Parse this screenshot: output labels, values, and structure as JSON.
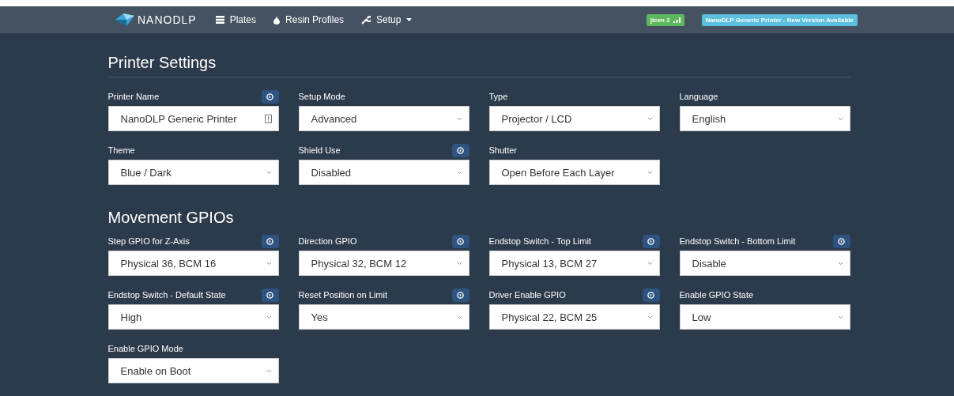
{
  "navbar": {
    "brand": "NANODLP",
    "items": [
      {
        "label": "Plates",
        "dropdown": false
      },
      {
        "label": "Resin Profiles",
        "dropdown": false
      },
      {
        "label": "Setup",
        "dropdown": true
      }
    ],
    "badges": [
      {
        "label": "jicen 2",
        "kind": "wifi",
        "color": "#5cb85c"
      },
      {
        "label": "NanoDLP Generic Printer - New Version Available",
        "kind": "plain",
        "color": "#5bc0de"
      }
    ]
  },
  "sections": [
    {
      "title": "Printer Settings",
      "divider": true,
      "fields": [
        {
          "label": "Printer Name",
          "info": true,
          "kind": "text",
          "value": "NanoDLP Generic Printer"
        },
        {
          "label": "Setup Mode",
          "info": false,
          "kind": "select",
          "value": "Advanced"
        },
        {
          "label": "Type",
          "info": false,
          "kind": "select",
          "value": "Projector / LCD"
        },
        {
          "label": "Language",
          "info": false,
          "kind": "select",
          "value": "English"
        },
        {
          "label": "Theme",
          "info": false,
          "kind": "select",
          "value": "Blue / Dark"
        },
        {
          "label": "Shield Use",
          "info": true,
          "kind": "select",
          "value": "Disabled"
        },
        {
          "label": "Shutter",
          "info": false,
          "kind": "select",
          "value": "Open Before Each Layer"
        }
      ]
    },
    {
      "title": "Movement GPIOs",
      "divider": false,
      "fields": [
        {
          "label": "Step GPIO for Z-Axis",
          "info": true,
          "kind": "select",
          "value": "Physical 36, BCM 16"
        },
        {
          "label": "Direction GPIO",
          "info": true,
          "kind": "select",
          "value": "Physical 32, BCM 12"
        },
        {
          "label": "Endstop Switch - Top Limit",
          "info": true,
          "kind": "select",
          "value": "Physical 13, BCM 27"
        },
        {
          "label": "Endstop Switch - Bottom Limit",
          "info": true,
          "kind": "select",
          "value": "Disable"
        },
        {
          "label": "Endstop Switch - Default State",
          "info": true,
          "kind": "select",
          "value": "High"
        },
        {
          "label": "Reset Position on Limit",
          "info": true,
          "kind": "select",
          "value": "Yes"
        },
        {
          "label": "Driver Enable GPIO",
          "info": true,
          "kind": "select",
          "value": "Physical 22, BCM 25"
        },
        {
          "label": "Enable GPIO State",
          "info": false,
          "kind": "select",
          "value": "Low"
        },
        {
          "label": "Enable GPIO Mode",
          "info": false,
          "kind": "select",
          "value": "Enable on Boot"
        }
      ]
    }
  ]
}
